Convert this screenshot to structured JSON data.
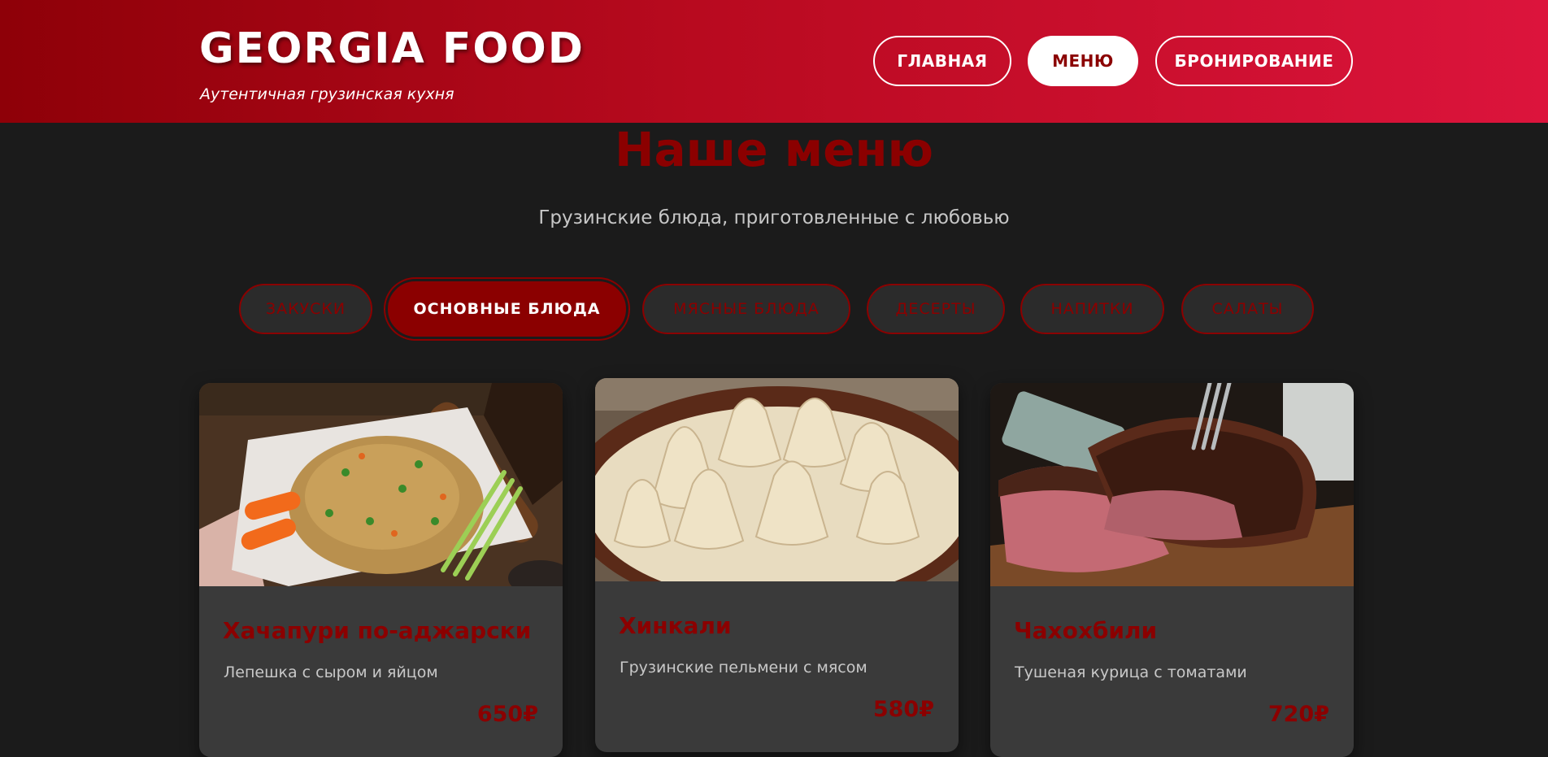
{
  "header": {
    "logo": "GEORGIA FOOD",
    "tagline": "Аутентичная грузинская кухня",
    "nav": [
      {
        "label": "ГЛАВНАЯ",
        "active": false
      },
      {
        "label": "МЕНЮ",
        "active": true
      },
      {
        "label": "БРОНИРОВАНИЕ",
        "active": false
      }
    ]
  },
  "main": {
    "title": "Наше меню",
    "subtitle": "Грузинские блюда, приготовленные с любовью",
    "filters": [
      {
        "label": "ЗАКУСКИ",
        "active": false
      },
      {
        "label": "ОСНОВНЫЕ БЛЮДА",
        "active": true
      },
      {
        "label": "МЯСНЫЕ БЛЮДА",
        "active": false
      },
      {
        "label": "ДЕСЕРТЫ",
        "active": false
      },
      {
        "label": "НАПИТКИ",
        "active": false
      },
      {
        "label": "САЛАТЫ",
        "active": false
      }
    ],
    "dishes": [
      {
        "name": "Хачапури по-аджарски",
        "description": "Лепешка с сыром и яйцом",
        "price": "650₽"
      },
      {
        "name": "Хинкали",
        "description": "Грузинские пельмени с мясом",
        "price": "580₽"
      },
      {
        "name": "Чахохбили",
        "description": "Тушеная курица с томатами",
        "price": "720₽"
      }
    ]
  },
  "colors": {
    "accent": "#8b0000",
    "header_start": "#8e0008",
    "header_end": "#dc143c",
    "background": "#1b1b1b",
    "card": "#3a3a3a"
  }
}
